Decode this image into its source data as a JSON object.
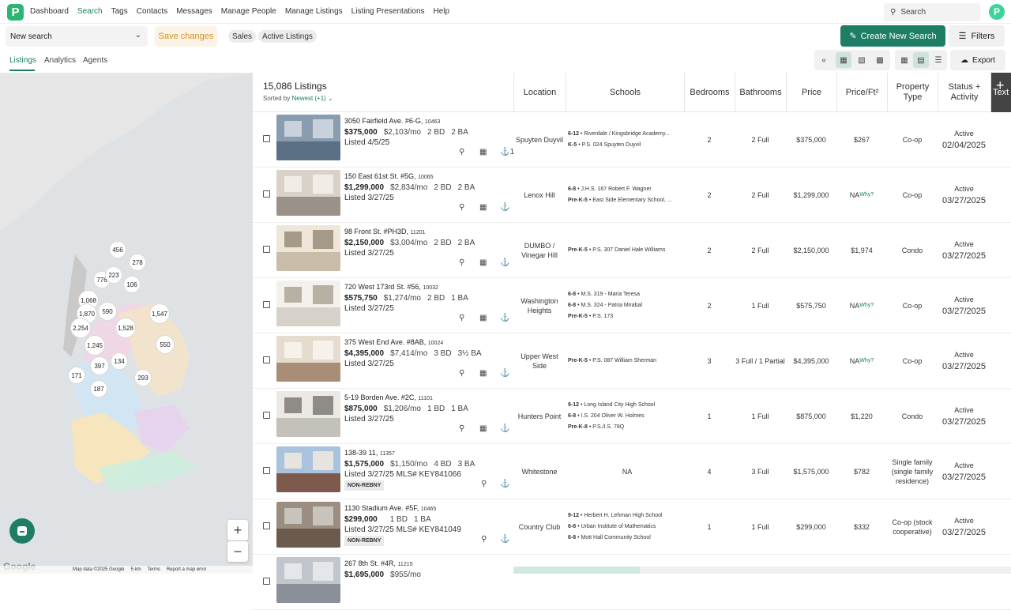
{
  "app": {
    "logo_letter": "P",
    "avatar_letter": "P",
    "accent": "#1e7e65"
  },
  "nav": {
    "items": [
      "Dashboard",
      "Search",
      "Tags",
      "Contacts",
      "Messages",
      "Manage People",
      "Manage Listings",
      "Listing Presentations",
      "Help"
    ],
    "active": "Search",
    "search_placeholder": "Search"
  },
  "toolbar": {
    "search_select": "New search",
    "save_label": "Save changes",
    "chips": [
      "Sales",
      "Active Listings"
    ],
    "create_label": "Create New Search",
    "filters_label": "Filters",
    "export_label": "Export"
  },
  "subtabs": [
    "Listings",
    "Analytics",
    "Agents"
  ],
  "map": {
    "clusters": [
      "456",
      "278",
      "776",
      "223",
      "106",
      "1,068",
      "1,870",
      "590",
      "1,547",
      "2,254",
      "1,528",
      "1,245",
      "550",
      "397",
      "134",
      "171",
      "293",
      "187"
    ],
    "footer": [
      "Map data ©2025 Google",
      "5 km",
      "Terms",
      "Report a map error"
    ],
    "google": "Google"
  },
  "list": {
    "count": "15,086 Listings",
    "sorted_prefix": "Sorted by",
    "sorted_value": "Newest (+1) ⌄",
    "columns": [
      "Location",
      "Schools",
      "Bedrooms",
      "Bathrooms",
      "Price",
      "Price/Ft²",
      "Property Type",
      "Status + Activity",
      "Text"
    ],
    "rows": [
      {
        "addr": "3050 Fairfield Ave. #6-G,",
        "zip": "10463",
        "price": "$375,000",
        "monthly": "$2,103/mo",
        "bd": "2 BD",
        "ba": "2 BA",
        "listed": "Listed 4/5/25",
        "tagcount": "1",
        "badge": "",
        "location": "Spuyten Duyvil",
        "schools": [
          [
            "6-12",
            "Riverdale / Kingsbridge Academy..."
          ],
          [
            "K-5",
            "P.S. 024 Spuyten Duyvil"
          ]
        ],
        "bedrooms": "2",
        "bathrooms": "2 Full",
        "price_col": "$375,000",
        "ppsf": "$267",
        "why": "",
        "type": "Co-op",
        "status": "Active",
        "date": "02/04/2025"
      },
      {
        "addr": "150 East 61st St. #5G,",
        "zip": "10065",
        "price": "$1,299,000",
        "monthly": "$2,834/mo",
        "bd": "2 BD",
        "ba": "2 BA",
        "listed": "Listed 3/27/25",
        "tagcount": "",
        "badge": "",
        "location": "Lenox Hill",
        "schools": [
          [
            "6-8",
            "J.H.S. 167 Robert F. Wagner"
          ],
          [
            "Pre-K-5",
            "East Side Elementary School, ..."
          ]
        ],
        "bedrooms": "2",
        "bathrooms": "2 Full",
        "price_col": "$1,299,000",
        "ppsf": "NA",
        "why": "Why?",
        "type": "Co-op",
        "status": "Active",
        "date": "03/27/2025"
      },
      {
        "addr": "98 Front St. #PH3D,",
        "zip": "11201",
        "price": "$2,150,000",
        "monthly": "$3,004/mo",
        "bd": "2 BD",
        "ba": "2 BA",
        "listed": "Listed 3/27/25",
        "tagcount": "",
        "badge": "",
        "location": "DUMBO / Vinegar Hill",
        "schools": [
          [
            "Pre-K-5",
            "P.S. 307 Daniel Hale Williams"
          ]
        ],
        "bedrooms": "2",
        "bathrooms": "2 Full",
        "price_col": "$2,150,000",
        "ppsf": "$1,974",
        "why": "",
        "type": "Condo",
        "status": "Active",
        "date": "03/27/2025"
      },
      {
        "addr": "720 West 173rd St. #56,",
        "zip": "10032",
        "price": "$575,750",
        "monthly": "$1,274/mo",
        "bd": "2 BD",
        "ba": "1 BA",
        "listed": "Listed 3/27/25",
        "tagcount": "",
        "badge": "",
        "location": "Washington Heights",
        "schools": [
          [
            "6-8",
            "M.S. 319 - Maria Teresa"
          ],
          [
            "6-8",
            "M.S. 324 - Patria Mirabal"
          ],
          [
            "Pre-K-5",
            "P.S. 173"
          ]
        ],
        "bedrooms": "2",
        "bathrooms": "1 Full",
        "price_col": "$575,750",
        "ppsf": "NA",
        "why": "Why?",
        "type": "Co-op",
        "status": "Active",
        "date": "03/27/2025"
      },
      {
        "addr": "375 West End Ave. #8AB,",
        "zip": "10024",
        "price": "$4,395,000",
        "monthly": "$7,414/mo",
        "bd": "3 BD",
        "ba": "3½ BA",
        "listed": "Listed 3/27/25",
        "tagcount": "",
        "badge": "",
        "location": "Upper West Side",
        "schools": [
          [
            "Pre-K-5",
            "P.S. 087 William Sherman"
          ]
        ],
        "bedrooms": "3",
        "bathrooms": "3 Full / 1 Partial",
        "price_col": "$4,395,000",
        "ppsf": "NA",
        "why": "Why?",
        "type": "Co-op",
        "status": "Active",
        "date": "03/27/2025"
      },
      {
        "addr": "5-19 Borden Ave. #2C,",
        "zip": "11101",
        "price": "$875,000",
        "monthly": "$1,206/mo",
        "bd": "1 BD",
        "ba": "1 BA",
        "listed": "Listed 3/27/25",
        "tagcount": "",
        "badge": "",
        "location": "Hunters Point",
        "schools": [
          [
            "9-12",
            "Long Island City High School"
          ],
          [
            "6-8",
            "I.S. 204 Oliver W. Holmes"
          ],
          [
            "Pre-K-8",
            "P.S./I.S. 78Q"
          ]
        ],
        "bedrooms": "1",
        "bathrooms": "1 Full",
        "price_col": "$875,000",
        "ppsf": "$1,220",
        "why": "",
        "type": "Condo",
        "status": "Active",
        "date": "03/27/2025"
      },
      {
        "addr": "138-39 11,",
        "zip": "11357",
        "price": "$1,575,000",
        "monthly": "$1,150/mo",
        "bd": "4 BD",
        "ba": "3 BA",
        "listed": "Listed 3/27/25 MLS# KEY841066",
        "tagcount": "",
        "badge": "NON-REBNY",
        "location": "Whitestone",
        "schools": [],
        "schools_na": "NA",
        "bedrooms": "4",
        "bathrooms": "3 Full",
        "price_col": "$1,575,000",
        "ppsf": "$782",
        "why": "",
        "type": "Single family (single family residence)",
        "status": "Active",
        "date": "03/27/2025"
      },
      {
        "addr": "1130 Stadium Ave. #5F,",
        "zip": "10465",
        "price": "$299,000",
        "monthly": "",
        "bd": "1 BD",
        "ba": "1 BA",
        "listed": "Listed 3/27/25 MLS# KEY841049",
        "tagcount": "",
        "badge": "NON-REBNY",
        "location": "Country Club",
        "schools": [
          [
            "9-12",
            "Herbert H. Lehman High School"
          ],
          [
            "6-8",
            "Urban Institute of Mathematics"
          ],
          [
            "6-8",
            "Mott Hall Community School"
          ]
        ],
        "bedrooms": "1",
        "bathrooms": "1 Full",
        "price_col": "$299,000",
        "ppsf": "$332",
        "why": "",
        "type": "Co-op (stock cooperative)",
        "status": "Active",
        "date": "03/27/2025"
      },
      {
        "addr": "267 8th St. #4R,",
        "zip": "11215",
        "price": "$1,695,000",
        "monthly": "$955/mo",
        "bd": "",
        "ba": "",
        "listed": "",
        "tagcount": "",
        "badge": "",
        "location": "",
        "schools": [],
        "bedrooms": "",
        "bathrooms": "",
        "price_col": "",
        "ppsf": "",
        "why": "",
        "type": "",
        "status": "",
        "date": ""
      }
    ]
  }
}
